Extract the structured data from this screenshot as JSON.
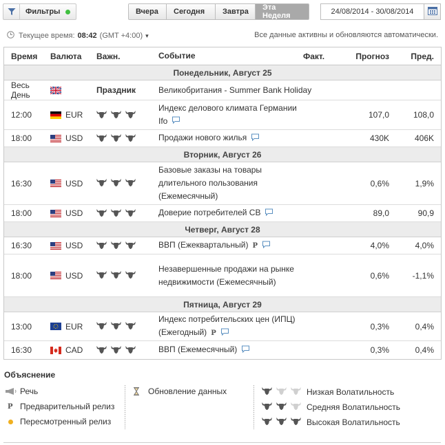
{
  "toolbar": {
    "filters_label": "Фильтры",
    "tabs": [
      "Вчера",
      "Сегодня",
      "Завтра",
      "Эта Неделя"
    ],
    "active_tab": "Эта Неделя",
    "date_range": "24/08/2014 - 30/08/2014"
  },
  "status": {
    "time_label": "Текущее время:",
    "time_value": "08:42",
    "timezone": "(GMT +4:00)",
    "auto_note": "Все данные активны и обновляются автоматически."
  },
  "columns": {
    "time": "Время",
    "currency": "Валюта",
    "importance": "Важн.",
    "event": "Событие",
    "actual": "Факт.",
    "forecast": "Прогноз",
    "previous": "Пред."
  },
  "days": [
    {
      "label": "Понедельник, Август 25",
      "events": [
        {
          "time": "Весь День",
          "currency": "",
          "flag": "gb",
          "importance_text": "Праздник",
          "importance": 0,
          "event": "Великобритания - Summer Bank Holiday",
          "actual": "",
          "forecast": "",
          "previous": "",
          "p": false,
          "bubble": false
        },
        {
          "time": "12:00",
          "currency": "EUR",
          "flag": "de",
          "importance_text": "",
          "importance": 3,
          "event": "Индекс делового климата Германии Ifo",
          "actual": "",
          "forecast": "107,0",
          "previous": "108,0",
          "p": false,
          "bubble": true
        },
        {
          "time": "18:00",
          "currency": "USD",
          "flag": "us",
          "importance_text": "",
          "importance": 3,
          "event": "Продажи нового жилья",
          "actual": "",
          "forecast": "430K",
          "previous": "406K",
          "p": false,
          "bubble": true
        }
      ]
    },
    {
      "label": "Вторник, Август 26",
      "events": [
        {
          "time": "16:30",
          "currency": "USD",
          "flag": "us",
          "importance_text": "",
          "importance": 3,
          "event": "Базовые заказы на товары длительного пользования (Ежемесячный)",
          "actual": "",
          "forecast": "0,6%",
          "previous": "1,9%",
          "p": false,
          "bubble": false
        },
        {
          "time": "18:00",
          "currency": "USD",
          "flag": "us",
          "importance_text": "",
          "importance": 3,
          "event": "Доверие потребителей CB",
          "actual": "",
          "forecast": "89,0",
          "previous": "90,9",
          "p": false,
          "bubble": true
        }
      ]
    },
    {
      "label": "Четверг, Август 28",
      "events": [
        {
          "time": "16:30",
          "currency": "USD",
          "flag": "us",
          "importance_text": "",
          "importance": 3,
          "event": "ВВП (Ежеквартальный)",
          "actual": "",
          "forecast": "4,0%",
          "previous": "4,0%",
          "p": true,
          "bubble": true
        },
        {
          "time": "18:00",
          "currency": "USD",
          "flag": "us",
          "importance_text": "",
          "importance": 3,
          "event": "Незавершенные продажи на рынке недвижимости (Ежемесячный)",
          "actual": "",
          "forecast": "0,6%",
          "previous": "-1,1%",
          "p": false,
          "bubble": false
        }
      ]
    },
    {
      "label": "Пятница, Август 29",
      "events": [
        {
          "time": "13:00",
          "currency": "EUR",
          "flag": "eu",
          "importance_text": "",
          "importance": 3,
          "event": "Индекс потребительских цен (ИПЦ) (Ежегодный)",
          "actual": "",
          "forecast": "0,3%",
          "previous": "0,4%",
          "p": true,
          "bubble": true
        },
        {
          "time": "16:30",
          "currency": "CAD",
          "flag": "ca",
          "importance_text": "",
          "importance": 3,
          "event": "ВВП (Ежемесячный)",
          "actual": "",
          "forecast": "0,3%",
          "previous": "0,4%",
          "p": false,
          "bubble": true
        }
      ]
    }
  ],
  "legend": {
    "title": "Объяснение",
    "speech": "Речь",
    "preliminary": "Предварительный релиз",
    "revised": "Пересмотренный релиз",
    "update": "Обновление данных",
    "low": "Низкая Волатильность",
    "medium": "Средняя Волатильность",
    "high": "Высокая Волатильность",
    "p_symbol": "P"
  },
  "colors": {
    "active_tab": "#a9a9a9",
    "filter_dot": "#3fbf3f",
    "revised_dot": "#f0b020",
    "day_header_bg": "#ececec",
    "bull_on": "#555555",
    "bull_off": "#d0d0d0"
  },
  "icons": [
    "filter-icon",
    "calendar-icon",
    "clock-icon",
    "bull-icon",
    "comment-bubble-icon",
    "speech-megaphone-icon",
    "hourglass-icon"
  ]
}
